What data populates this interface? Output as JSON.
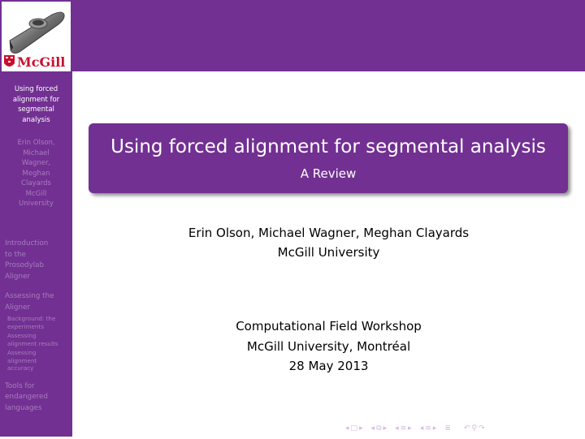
{
  "sidebar": {
    "logo_text": "McGill",
    "title": "Using forced alignment for segmental analysis",
    "title_lines": [
      "Using forced",
      "alignment for",
      "segmental",
      "analysis"
    ],
    "author_lines": [
      "Erin Olson,",
      "Michael",
      "Wagner,",
      "Meghan",
      "Clayards",
      "McGill",
      "University"
    ],
    "sections": [
      {
        "label_lines": [
          "Introduction",
          "to the",
          "Prosodylab",
          "Aligner"
        ],
        "subsections": []
      },
      {
        "label_lines": [
          "Assessing the",
          "Aligner"
        ],
        "subsections": [
          {
            "label_lines": [
              "Background: the",
              "experiments"
            ]
          },
          {
            "label_lines": [
              "Assessing",
              "alignment results"
            ]
          },
          {
            "label_lines": [
              "Assessing",
              "alignment",
              "accuracy"
            ]
          }
        ]
      },
      {
        "label_lines": [
          "Tools for",
          "endangered",
          "languages"
        ],
        "subsections": []
      }
    ]
  },
  "title_box": {
    "title": "Using forced alignment for segmental analysis",
    "subtitle": "A Review"
  },
  "authors": {
    "names": "Erin Olson, Michael Wagner, Meghan Clayards",
    "institution": "McGill University"
  },
  "event": {
    "name": "Computational Field Workshop",
    "location": "McGill University, Montréal",
    "date": "28 May 2013"
  },
  "navbar": {
    "icons": [
      "frame-prev",
      "frame-icon",
      "frame-next",
      "subsection-prev",
      "subsection-icon",
      "subsection-next",
      "section-prev",
      "section-icon",
      "section-next",
      "subsubsection-prev",
      "subsubsection-icon",
      "subsubsection-next",
      "document-icon",
      "undo-icon",
      "search-icon",
      "redo-icon"
    ]
  },
  "colors": {
    "theme_purple": "#723092",
    "sidebar_inactive": "#a67dbd",
    "navbar": "#d6b8e3"
  }
}
